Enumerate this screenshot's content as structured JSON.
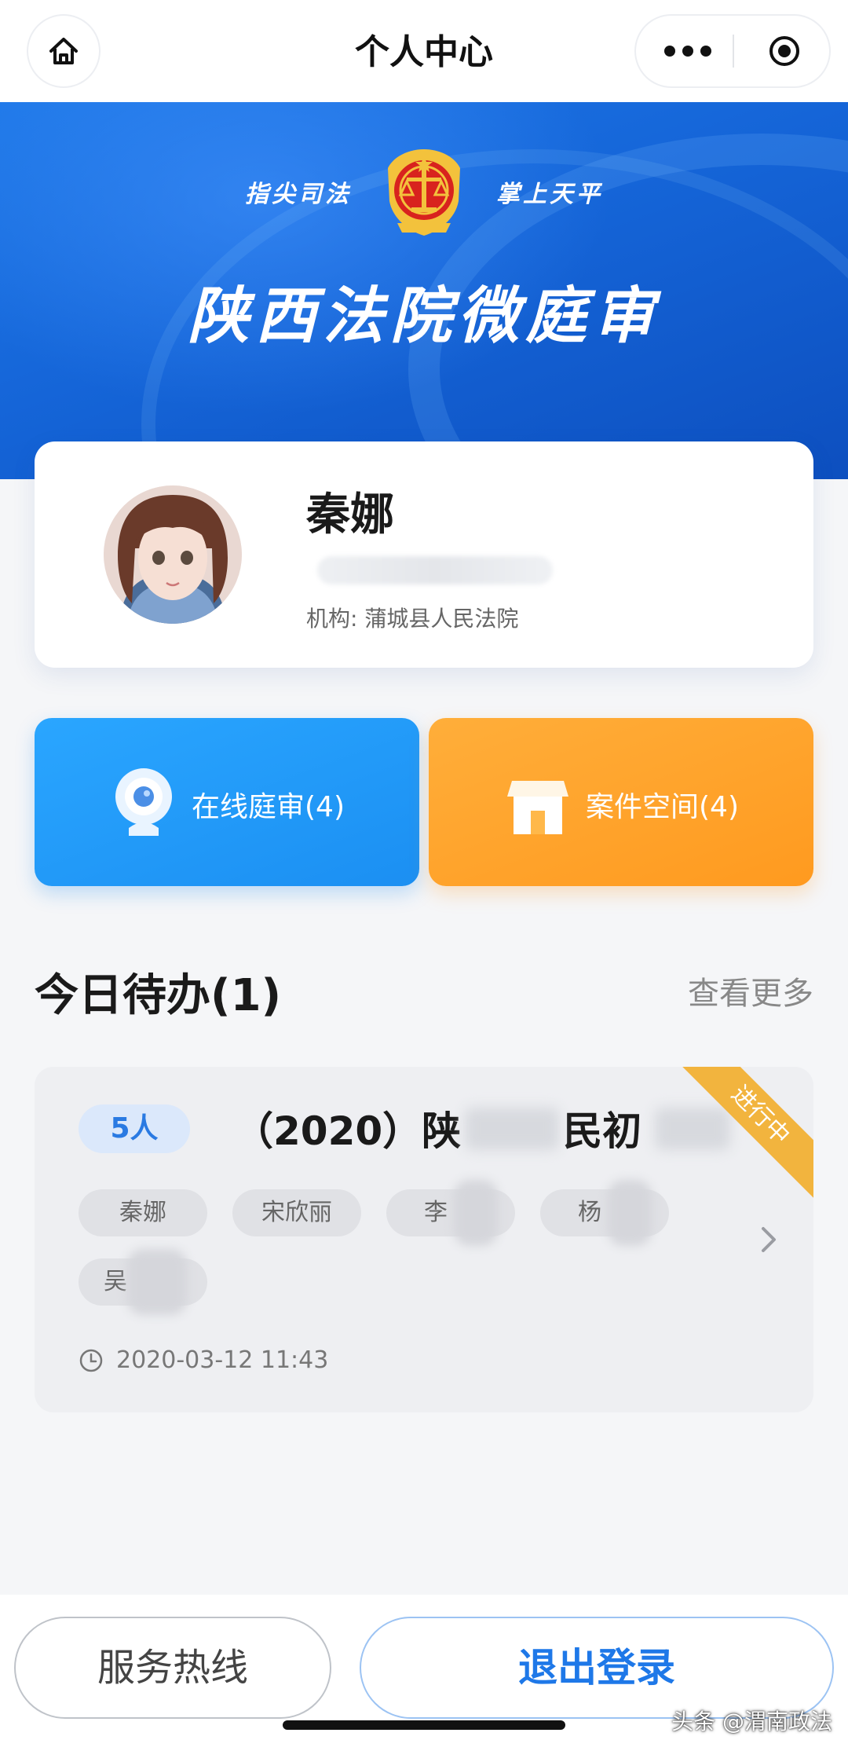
{
  "nav": {
    "title": "个人中心",
    "home_icon": "home-icon",
    "more_icon": "more-dots-icon",
    "close_icon": "target-icon"
  },
  "banner": {
    "slogan_left": "指尖司法",
    "slogan_right": "掌上天平",
    "title": "陕西法院微庭审",
    "colors": {
      "primary": "#1565d8",
      "emblem_red": "#d8231e",
      "emblem_gold": "#f3c23c"
    }
  },
  "profile": {
    "name": "秦娜",
    "org": "机构: 蒲城县人民法院"
  },
  "actions": {
    "online": {
      "label": "在线庭审(4)",
      "icon": "webcam-icon",
      "color": "#1b8ff2"
    },
    "cases": {
      "label": "案件空间(4)",
      "icon": "house-icon",
      "color": "#ff9a1f"
    }
  },
  "todo": {
    "title": "今日待办(1)",
    "more": "查看更多",
    "card": {
      "count": "5人",
      "case_prefix": "（2020）陕",
      "case_middle": "民初",
      "status": "进行中",
      "participants": [
        "秦娜",
        "宋欣丽",
        "李",
        "杨",
        "吴"
      ],
      "time": "2020-03-12 11:43"
    }
  },
  "bottom": {
    "hotline": "服务热线",
    "logout": "退出登录"
  },
  "watermark": "头条 @渭南政法"
}
